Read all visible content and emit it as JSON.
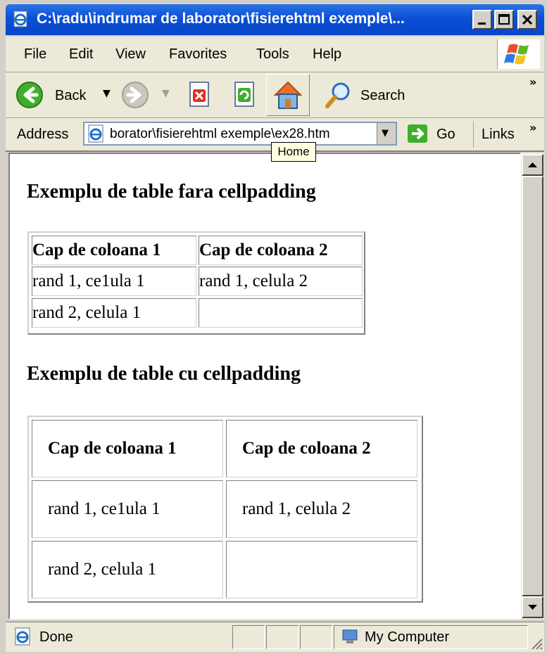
{
  "window": {
    "title": "C:\\radu\\indrumar de laborator\\fisierehtml exemple\\..."
  },
  "menu": [
    "File",
    "Edit",
    "View",
    "Favorites",
    "Tools",
    "Help"
  ],
  "toolbar": {
    "back_label": "Back",
    "search_label": "Search"
  },
  "address": {
    "label": "Address",
    "url": "borator\\fisierehtml exemple\\ex28.htm",
    "go_label": "Go",
    "links_label": "Links"
  },
  "tooltip": "Home",
  "page": {
    "heading1": "Exemplu de table fara cellpadding",
    "heading2": "Exemplu de table cu cellpadding",
    "table1": {
      "headers": [
        "Cap de coloana 1",
        "Cap de coloana 2"
      ],
      "rows": [
        [
          "rand 1, ce1ula 1",
          "rand 1, celula 2"
        ],
        [
          "rand 2, celula 1",
          ""
        ]
      ]
    },
    "table2": {
      "headers": [
        "Cap de coloana 1",
        "Cap de coloana 2"
      ],
      "rows": [
        [
          "rand 1, ce1ula 1",
          "rand 1, celula 2"
        ],
        [
          "rand 2, celula 1",
          ""
        ]
      ]
    }
  },
  "status": {
    "text": "Done",
    "zone": "My Computer"
  }
}
